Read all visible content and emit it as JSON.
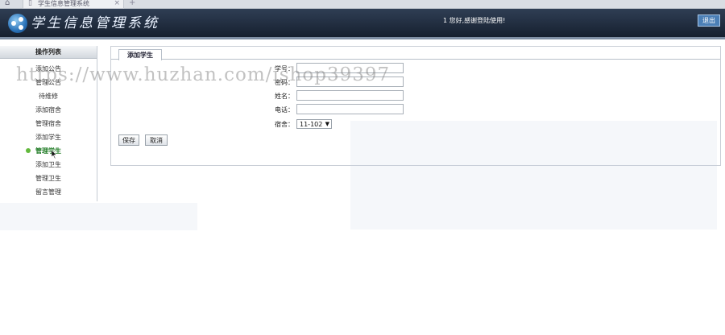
{
  "browser": {
    "tab_title": "学生信息管理系统",
    "home_icon": "home-icon",
    "close_icon": "close-icon",
    "newtab_icon": "plus-icon"
  },
  "header": {
    "app_title": "学生信息管理系统",
    "welcome": "1 您好,感谢登陆使用!",
    "logout_label": "退出",
    "colors": {
      "header_bg": "#1f2b3c",
      "accent": "#4b7fb6"
    }
  },
  "sidebar": {
    "title": "操作列表",
    "items": [
      {
        "label": "添加公告"
      },
      {
        "label": "管理公告"
      },
      {
        "label": "待维修"
      },
      {
        "label": "添加宿舍"
      },
      {
        "label": "管理宿舍"
      },
      {
        "label": "添加学生"
      },
      {
        "label": "管理学生",
        "active": true
      },
      {
        "label": "添加卫生"
      },
      {
        "label": "管理卫生"
      },
      {
        "label": "留言管理"
      }
    ]
  },
  "form": {
    "tab_label": "添加学生",
    "fields": [
      {
        "label": "学号：",
        "value": ""
      },
      {
        "label": "密码：",
        "value": ""
      },
      {
        "label": "姓名：",
        "value": ""
      },
      {
        "label": "电话：",
        "value": ""
      }
    ],
    "dorm_label": "宿舍：",
    "dorm_selected": "11-102",
    "save_label": "保存",
    "cancel_label": "取消"
  },
  "watermark": "https://www.huzhan.com/ishop39397"
}
